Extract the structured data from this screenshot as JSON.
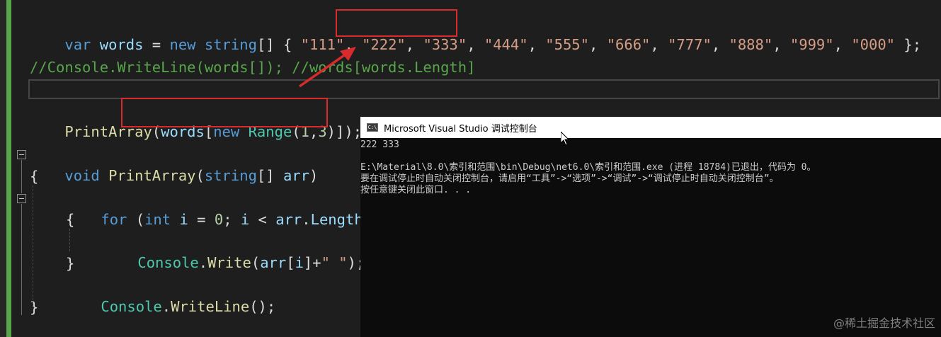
{
  "editor": {
    "lines": {
      "words_decl": {
        "var": "var",
        "name": "words",
        "eq": " = ",
        "new": "new",
        "sp": " ",
        "type": "string",
        "brackets": "[] { ",
        "s111": "\"111\"",
        "s222": "\"222\"",
        "s333": "\"333\"",
        "s444": "\"444\"",
        "s555": "\"555\"",
        "s666": "\"666\"",
        "s777": "\"777\"",
        "s888": "\"888\"",
        "s999": "\"999\"",
        "s000": "\"000\"",
        "comma": ", ",
        "end": " };"
      },
      "comment": "//Console.WriteLine(words[]); //words[words.Length]",
      "call": {
        "fn": "PrintArray",
        "open": "(",
        "arg": "words",
        "lb": "[",
        "new": "new",
        "range": "Range",
        "args_open": "(",
        "a1": "1",
        "sep": ",",
        "a2": "3",
        "close": ")]",
        "end": ");"
      },
      "method_decl": {
        "void": "void",
        "fn": "PrintArray",
        "open": "(",
        "type": "string",
        "rest": "[] ",
        "param": "arr",
        "close": ")"
      },
      "open_brace": "{",
      "for_line": {
        "for": "for",
        "p1": " (",
        "int": "int",
        "p2": " ",
        "i": "i",
        "p3": " = ",
        "zero": "0",
        "p4": "; ",
        "i2": "i",
        "p5": " < ",
        "arr": "arr",
        "p6": ".",
        "len": "Length",
        "p7": ";"
      },
      "inner_open": "{",
      "write_line": {
        "cls": "Console",
        "dot": ".",
        "fn": "Write",
        "p1": "(",
        "arr": "arr",
        "p2": "[",
        "i": "i",
        "p3": "]+",
        "str": "\" \"",
        "p4": ");"
      },
      "inner_close": "}",
      "writeline": {
        "cls": "Console",
        "dot": ".",
        "fn": "WriteLine",
        "rest": "();"
      },
      "close_brace": "}"
    }
  },
  "console": {
    "icon_text": "C:\\",
    "title": "Microsoft Visual Studio 调试控制台",
    "output": [
      "222 333",
      "",
      "E:\\Material\\8.0\\索引和范围\\bin\\Debug\\net6.0\\索引和范围.exe (进程 18784)已退出，代码为 0。",
      "要在调试停止时自动关闭控制台，请启用“工具”->“选项”->“调试”->“调试停止时自动关闭控制台”。",
      "按任意键关闭此窗口. . ."
    ]
  },
  "watermark": "@稀土掘金技术社区",
  "colors": {
    "keyword": "#569cd6",
    "variable": "#9cdcfe",
    "string": "#d69d85",
    "number": "#b5cea8",
    "comment": "#57a64a",
    "method": "#dcdcaa",
    "class": "#4ec9b0",
    "highlight": "#d92b2b"
  },
  "icons": [
    "console-app-icon",
    "mouse-cursor-icon",
    "annotation-arrow-icon",
    "fold-collapse-icon"
  ]
}
